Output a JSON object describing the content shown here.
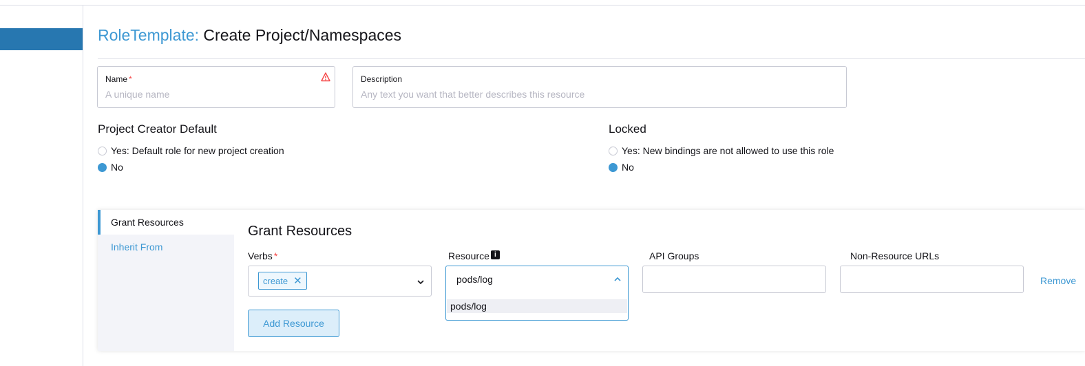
{
  "header": {
    "kind": "RoleTemplate:",
    "title": "Create Project/Namespaces"
  },
  "form": {
    "name": {
      "label": "Name",
      "required_mark": "*",
      "placeholder": "A unique name",
      "warning_icon": "warning-triangle-icon"
    },
    "description": {
      "label": "Description",
      "placeholder": "Any text you want that better describes this resource"
    }
  },
  "project_creator_default": {
    "title": "Project Creator Default",
    "options": [
      {
        "label": "Yes: Default role for new project creation",
        "selected": false
      },
      {
        "label": "No",
        "selected": true
      }
    ]
  },
  "locked": {
    "title": "Locked",
    "options": [
      {
        "label": "Yes: New bindings are not allowed to use this role",
        "selected": false
      },
      {
        "label": "No",
        "selected": true
      }
    ]
  },
  "tabs": [
    {
      "label": "Grant Resources",
      "active": true
    },
    {
      "label": "Inherit From",
      "active": false
    }
  ],
  "grant": {
    "heading": "Grant Resources",
    "columns": {
      "verbs": "Verbs",
      "verbs_required": "*",
      "resource": "Resource",
      "resource_info_icon": "info-icon",
      "api_groups": "API Groups",
      "non_resource_urls": "Non-Resource URLs"
    },
    "row": {
      "verb_tag": "create",
      "verb_tag_remove": "✕",
      "resource_value": "pods/log",
      "resource_option": "pods/log",
      "remove_label": "Remove"
    },
    "add_button": "Add Resource"
  },
  "colors": {
    "accent": "#3d98d3",
    "nav_active": "#2777b0",
    "required": "#f64747"
  }
}
